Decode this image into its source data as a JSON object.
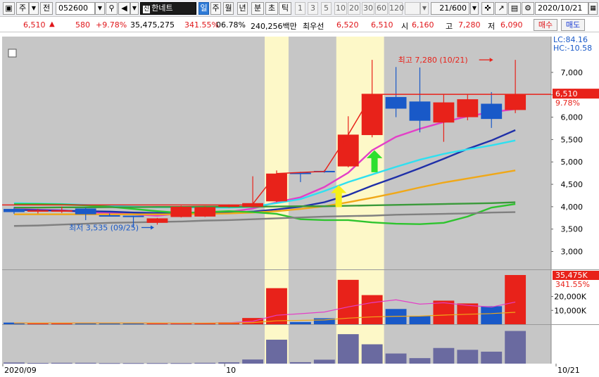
{
  "toolbar": {
    "mode": "주",
    "mode_side": "전",
    "code": "052600",
    "badge": "신",
    "name": "한네트",
    "periods": [
      "일",
      "주",
      "월",
      "년",
      "분",
      "초",
      "틱"
    ],
    "selected_period": "일",
    "intervals": [
      "1",
      "3",
      "5",
      "10",
      "20",
      "30",
      "60",
      "120"
    ],
    "count": "21/600",
    "date": "2020/10/21"
  },
  "quote": {
    "price": "6,510",
    "arrow": "▲",
    "change": "580",
    "change_pct": "+9.78%",
    "volume": "35,475,275",
    "volume_pct": "341.55%",
    "turnover": "06.78%",
    "amount": "240,256백만",
    "best_ask_label": "최우선",
    "best_ask": "6,520",
    "best_bid": "6,510",
    "open_label": "시",
    "open": "6,160",
    "high_label": "고",
    "high": "7,280",
    "low_label": "저",
    "low": "6,090",
    "buy_label": "매수",
    "sell_label": "매도"
  },
  "colors": {
    "up": "#e8221a",
    "down": "#1959c8",
    "highlight": "#fdf8c8",
    "chart_bg": "#c6c6c6",
    "ma5": "#e33fc7",
    "ma10": "#1f2fa8",
    "ma20": "#2fe0f0",
    "ma60": "#f0a818",
    "ma120": "#2ec42e",
    "ma240": "#3a9a3a",
    "ma480": "#808080",
    "vol_bar": "#6a6aa0"
  },
  "chart_data": {
    "type": "candlestick",
    "price_axis": {
      "range": [
        2600,
        7800
      ],
      "ticks": [
        3000,
        3500,
        4000,
        4500,
        5000,
        5500,
        6000,
        6500,
        7000
      ],
      "tick_labels": [
        "3,000",
        "3,500",
        "4,000",
        "4,500",
        "5,000",
        "5,500",
        "6,000",
        "6,500",
        "7,000"
      ]
    },
    "corner_labels": {
      "lc": "LC:84.16",
      "hc": "HC:-10.58"
    },
    "current_price_label": "6,510",
    "current_pct_label": "9.78%",
    "volume_axis": {
      "range": [
        0,
        37000000
      ],
      "ticks": [
        10000000,
        20000000
      ],
      "tick_labels": [
        "10,000K",
        "20,000K"
      ]
    },
    "current_volume_label": "35,475K",
    "current_volume_pct": "341.55%",
    "x_labels": [
      {
        "index": 0,
        "text": "2020/09"
      },
      {
        "index": 9,
        "text": "10"
      },
      {
        "index": 22,
        "text": "10/21"
      }
    ],
    "annotations": {
      "high": "최고 7,280 (10/21)",
      "low": "최저 3,535 (09/25)"
    },
    "candles": [
      {
        "o": 3950,
        "h": 3990,
        "l": 3840,
        "c": 3880
      },
      {
        "o": 3900,
        "h": 3950,
        "l": 3850,
        "c": 3920
      },
      {
        "o": 3900,
        "h": 4000,
        "l": 3860,
        "c": 3920
      },
      {
        "o": 3960,
        "h": 3980,
        "l": 3700,
        "c": 3830
      },
      {
        "o": 3810,
        "h": 3850,
        "l": 3780,
        "c": 3800
      },
      {
        "o": 3800,
        "h": 3800,
        "l": 3535,
        "c": 3790
      },
      {
        "o": 3640,
        "h": 3750,
        "l": 3600,
        "c": 3740
      },
      {
        "o": 3770,
        "h": 4020,
        "l": 3760,
        "c": 4000
      },
      {
        "o": 3780,
        "h": 4010,
        "l": 3770,
        "c": 3990
      },
      {
        "o": 4000,
        "h": 4050,
        "l": 3980,
        "c": 4040
      },
      {
        "o": 4000,
        "h": 4680,
        "l": 3990,
        "c": 4080
      },
      {
        "o": 4120,
        "h": 4810,
        "l": 4100,
        "c": 4740
      },
      {
        "o": 4760,
        "h": 4780,
        "l": 4550,
        "c": 4740
      },
      {
        "o": 4800,
        "h": 4820,
        "l": 4760,
        "c": 4790
      },
      {
        "o": 4900,
        "h": 6020,
        "l": 4880,
        "c": 5610
      },
      {
        "o": 5600,
        "h": 7280,
        "l": 5550,
        "c": 6510
      },
      {
        "o": 6450,
        "h": 7120,
        "l": 6000,
        "c": 6190
      },
      {
        "o": 6350,
        "h": 7110,
        "l": 5660,
        "c": 5920
      },
      {
        "o": 5880,
        "h": 6520,
        "l": 5450,
        "c": 6330
      },
      {
        "o": 6000,
        "h": 6510,
        "l": 5930,
        "c": 6400
      },
      {
        "o": 6300,
        "h": 6560,
        "l": 5760,
        "c": 5960
      },
      {
        "o": 6160,
        "h": 7280,
        "l": 6090,
        "c": 6510
      }
    ],
    "volumes": [
      1200000,
      700000,
      900000,
      900000,
      600000,
      600000,
      600000,
      600000,
      900000,
      1400000,
      4500000,
      26000000,
      1600000,
      4300000,
      32000000,
      21000000,
      11000000,
      6000000,
      17000000,
      15000000,
      13000000,
      35475275
    ],
    "highlight_bands": [
      [
        11,
        11
      ],
      [
        14,
        15
      ]
    ],
    "arrows": [
      {
        "index": 13.6,
        "color": "#f7f018",
        "price": 4470
      },
      {
        "index": 15.1,
        "color": "#2ee02e",
        "price": 5250
      }
    ],
    "moving_averages": [
      {
        "color": "#e33fc7",
        "values": [
          3950,
          3930,
          3920,
          3880,
          3860,
          3830,
          3800,
          3850,
          3870,
          3880,
          3960,
          4100,
          4210,
          4440,
          4760,
          5260,
          5560,
          5740,
          5890,
          6020,
          6110,
          6180
        ]
      },
      {
        "color": "#1f2fa8",
        "values": [
          3930,
          3920,
          3910,
          3900,
          3890,
          3870,
          3860,
          3860,
          3860,
          3870,
          3890,
          3940,
          4000,
          4100,
          4260,
          4470,
          4660,
          4860,
          5070,
          5290,
          5480,
          5710
        ]
      },
      {
        "color": "#2fe0f0",
        "values": [
          4080,
          4070,
          4060,
          4040,
          4020,
          4000,
          3990,
          3990,
          3980,
          3980,
          4000,
          4080,
          4170,
          4350,
          4550,
          4720,
          4890,
          5050,
          5180,
          5280,
          5370,
          5480
        ]
      },
      {
        "color": "#f0a818",
        "values": [
          3830,
          3830,
          3830,
          3830,
          3830,
          3830,
          3830,
          3830,
          3840,
          3850,
          3870,
          3900,
          3950,
          4010,
          4100,
          4200,
          4310,
          4430,
          4540,
          4630,
          4720,
          4810
        ]
      },
      {
        "color": "#2ec42e",
        "values": [
          4060,
          4060,
          4050,
          4030,
          4000,
          3950,
          3900,
          3860,
          3880,
          3900,
          3880,
          3840,
          3720,
          3700,
          3700,
          3650,
          3620,
          3610,
          3640,
          3780,
          3980,
          4060
        ]
      },
      {
        "color": "#3a9a3a",
        "values": [
          3980,
          3980,
          3985,
          3985,
          3990,
          3990,
          3995,
          3995,
          4000,
          4000,
          4000,
          4005,
          4010,
          4010,
          4020,
          4030,
          4040,
          4050,
          4060,
          4070,
          4080,
          4100
        ]
      },
      {
        "color": "#808080",
        "values": [
          3570,
          3580,
          3600,
          3620,
          3640,
          3650,
          3660,
          3670,
          3690,
          3700,
          3720,
          3740,
          3760,
          3780,
          3790,
          3800,
          3820,
          3830,
          3840,
          3850,
          3870,
          3880
        ]
      }
    ],
    "volume_ma": [
      {
        "color": "#e33fc7",
        "values": [
          800000,
          800000,
          850000,
          900000,
          850000,
          800000,
          750000,
          700000,
          800000,
          1100000,
          2100000,
          6500000,
          7600000,
          8800000,
          12500000,
          15600000,
          17600000,
          14500000,
          15500000,
          13600000,
          12400000,
          16000000
        ]
      },
      {
        "color": "#f0a818",
        "values": [
          900000,
          900000,
          900000,
          900000,
          900000,
          900000,
          880000,
          860000,
          850000,
          900000,
          1200000,
          2500000,
          2800000,
          3100000,
          4400000,
          5300000,
          5700000,
          5900000,
          6600000,
          7200000,
          7700000,
          8600000
        ]
      }
    ]
  }
}
